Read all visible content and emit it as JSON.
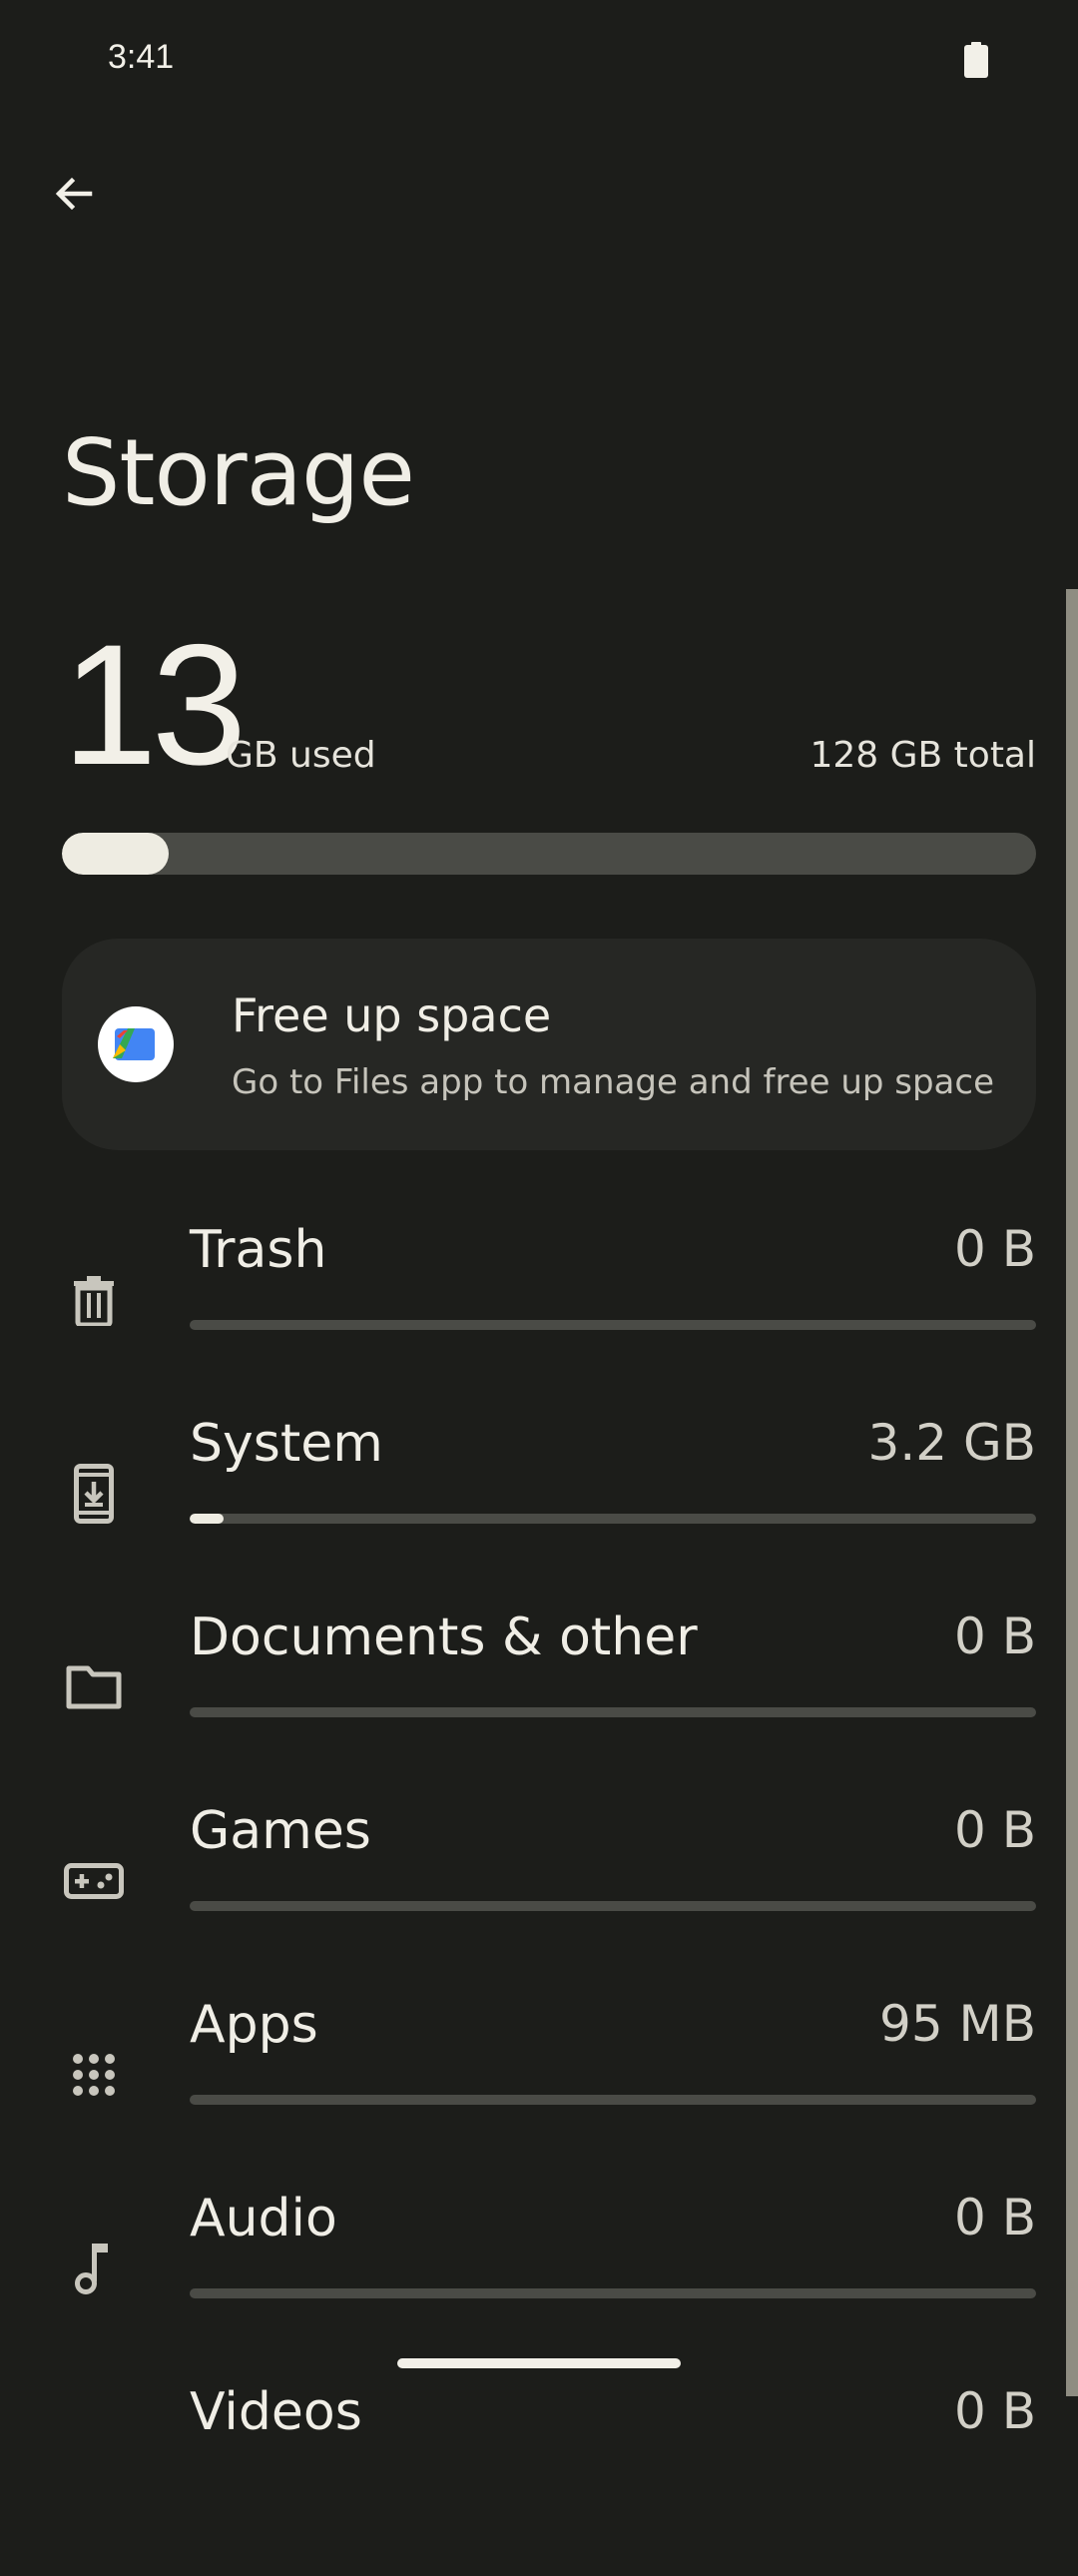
{
  "status_bar": {
    "time": "3:41",
    "battery_icon": "battery-full-icon"
  },
  "header": {
    "back_icon": "arrow-back-icon",
    "title": "Storage"
  },
  "summary": {
    "used_value": "13",
    "used_unit": "GB used",
    "total_label": "128 GB total",
    "used_fraction": 0.11
  },
  "free_up_card": {
    "icon": "files-app-icon",
    "title": "Free up space",
    "subtitle": "Go to Files app to manage and free up space"
  },
  "categories": [
    {
      "label": "Trash",
      "size": "0 B",
      "icon": "trash-icon",
      "fraction": 0
    },
    {
      "label": "System",
      "size": "3.2 GB",
      "icon": "system-phone-icon",
      "fraction": 0.04
    },
    {
      "label": "Documents & other",
      "size": "0 B",
      "icon": "folder-icon",
      "fraction": 0
    },
    {
      "label": "Games",
      "size": "0 B",
      "icon": "gamepad-icon",
      "fraction": 0
    },
    {
      "label": "Apps",
      "size": "95 MB",
      "icon": "apps-grid-icon",
      "fraction": 0
    },
    {
      "label": "Audio",
      "size": "0 B",
      "icon": "music-note-icon",
      "fraction": 0
    },
    {
      "label": "Videos",
      "size": "0 B",
      "icon": "video-icon",
      "fraction": 0
    }
  ],
  "colors": {
    "background": "#1c1d1a",
    "bar_track": "#4a4b46",
    "bar_fill": "#eeece2",
    "card": "#262724"
  }
}
